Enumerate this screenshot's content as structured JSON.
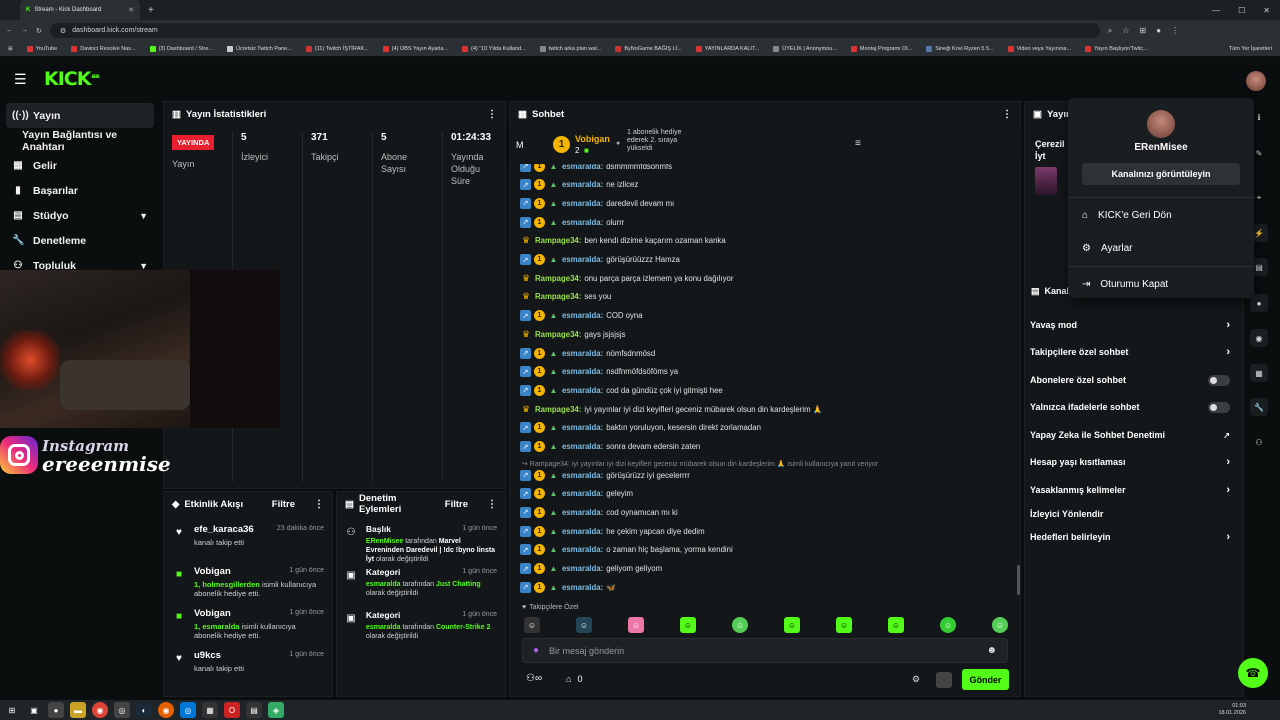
{
  "browser": {
    "tab_title": "Stream - Kick Dashboard",
    "url": "dashboard.kick.com/stream",
    "bookmarks": [
      "YouTube",
      "Davinci Resolve Nas...",
      "(3) Dashboard / Stre...",
      "Ücretsiz Twitch Pane...",
      "(11) Twitch İŞTİRAK...",
      "(4) OBS Yayın Ayarla...",
      "(4) \"10 Yılda Kulland...",
      "twitch arka plan wal...",
      "ByNoGame BAĞIŞ Lİ...",
      "YAYINLARDA KALIT...",
      "ÜYELİK | Anonymou...",
      "Montaj Programı Ol...",
      "Sineği Kovi Ryzen 5 5...",
      "Video veya Yayınına...",
      "Yayın Başlıyor/Twitc..."
    ],
    "bookmarks_all": "Tüm Yer İşaretleri"
  },
  "header": {
    "logo": "KICK",
    "beta": "BETA"
  },
  "sidebar": {
    "items": [
      {
        "label": "Yayın",
        "icon": "broadcast-icon"
      },
      {
        "label": "Yayın Bağlantısı ve Anahtarı",
        "icon": ""
      },
      {
        "label": "Gelir",
        "icon": "revenue-icon"
      },
      {
        "label": "Başarılar",
        "icon": "achievements-icon"
      },
      {
        "label": "Stüdyo",
        "icon": "studio-icon"
      },
      {
        "label": "Denetleme",
        "icon": "moderation-icon"
      },
      {
        "label": "Topluluk",
        "icon": "community-icon"
      }
    ]
  },
  "stats": {
    "title": "Yayın İstatistikleri",
    "live_badge": "YAYINDA",
    "live_label": "Yayın",
    "viewers": {
      "value": "5",
      "label": "İzleyici"
    },
    "followers": {
      "value": "371",
      "label": "Takipçi"
    },
    "subs": {
      "value": "5",
      "label": "Abone Sayısı"
    },
    "duration": {
      "value": "01:24:33",
      "label": "Yayında Olduğu Süre"
    }
  },
  "overlay": {
    "instagram_line1": "Instagram",
    "instagram_line2": "ereeenmise"
  },
  "chat": {
    "title": "Sohbet",
    "pinned_initial": "M",
    "gifter_name": "Vobigan",
    "gifter_count": "2",
    "gifter_note": "1 abonelik hediye ederek 2. sıraya yükseldi",
    "messages": [
      {
        "user": "esmaralda",
        "text": "dsmmmmfdsohmfs",
        "type": "sub"
      },
      {
        "user": "esmaralda",
        "text": "ne izlicez",
        "type": "sub"
      },
      {
        "user": "esmaralda",
        "text": "daredevil devam mı",
        "type": "sub"
      },
      {
        "user": "esmaralda",
        "text": "olurrr",
        "type": "sub"
      },
      {
        "user": "Rampage34",
        "text": "ben kendi dizime kaçarım ozaman kanka",
        "type": "mod"
      },
      {
        "user": "esmaralda",
        "text": "görüşürüüzzz Hamza",
        "type": "sub"
      },
      {
        "user": "Rampage34",
        "text": "onu parça parça izlemem ya konu dağılıyor",
        "type": "mod"
      },
      {
        "user": "Rampage34",
        "text": "ses you",
        "type": "mod"
      },
      {
        "user": "esmaralda",
        "text": "COD oyna",
        "type": "sub"
      },
      {
        "user": "Rampage34",
        "text": "gays jsjsjsjs",
        "type": "mod"
      },
      {
        "user": "esmaralda",
        "text": "nömfsdnmösd",
        "type": "sub"
      },
      {
        "user": "esmaralda",
        "text": "nsdfnmöfdsöföms ya",
        "type": "sub"
      },
      {
        "user": "esmaralda",
        "text": "cod da gündüz çok iyi gitmişti hee",
        "type": "sub"
      },
      {
        "user": "Rampage34",
        "text": "iyi yayınlar iyi dizi keyifleri geceniz mübarek olsun din kardeşlerim 🙏",
        "type": "mod"
      },
      {
        "user": "esmaralda",
        "text": "baktın yoruluyon, kesersin direkt zorlamadan",
        "type": "sub"
      },
      {
        "user": "esmaralda",
        "text": "sonra devam edersin zaten",
        "type": "sub"
      }
    ],
    "reply_note": "↪ Rampage34: iyi yayınlar iyi dizi keyifleri geceniz mübarek olsun din kardeşlerim 🙏 isimli kullanıcıya yanıt veriyor",
    "messages2": [
      {
        "user": "esmaralda",
        "text": "görüşürüzz iyi gecelerrrr"
      },
      {
        "user": "esmaralda",
        "text": "geleyim"
      },
      {
        "user": "esmaralda",
        "text": "cod oynamıcan mı ki"
      },
      {
        "user": "esmaralda",
        "text": "he çekim yapcan diye dedim"
      },
      {
        "user": "esmaralda",
        "text": "o zaman hiç başlama, yorma kendini"
      },
      {
        "user": "esmaralda",
        "text": "geliyom geliyom"
      },
      {
        "user": "esmaralda",
        "text": "🦋"
      }
    ],
    "followers_only": "Takipçilere Özel",
    "input_placeholder": "Bir mesaj gönderin",
    "viewer_count": "0",
    "send_label": "Gönder"
  },
  "activity": {
    "title": "Etkinlik Akışı",
    "filter": "Filtre",
    "items": [
      {
        "name": "efe_karaca36",
        "sub": "kanalı takip etti",
        "time": "23 dakika önce",
        "icon": "heart-icon"
      },
      {
        "name": "Vobigan",
        "sub_green": "1, holmesgillerden",
        "sub": "isimli kullanıcıya abonelik hediye etti.",
        "time": "1 gün önce",
        "icon": "gift-icon"
      },
      {
        "name": "Vobigan",
        "sub_green": "1, esmaralda",
        "sub": "isimli kullanıcıya abonelik hediye etti.",
        "time": "1 gün önce",
        "icon": "gift-icon"
      },
      {
        "name": "u9kcs",
        "sub": "kanalı takip etti",
        "time": "1 gün önce",
        "icon": "heart-icon"
      }
    ]
  },
  "modlog": {
    "title": "Denetim Eylemleri",
    "filter": "Filtre",
    "items": [
      {
        "name": "Başlık",
        "actor": "ERenMisee",
        "mid": "tarafından",
        "value": "Marvel Evreninden Daredevil | !dc !byno linsta İyt",
        "end": "olarak değiştirildi",
        "time": "1 gün önce"
      },
      {
        "name": "Kategori",
        "actor": "esmaralda",
        "mid": "tarafından",
        "value": "Just Chatting",
        "end": "olarak değiştirildi",
        "time": "1 gün önce"
      },
      {
        "name": "Kategori",
        "actor": "esmaralda",
        "mid": "tarafından",
        "value": "Counter-Strike 2",
        "end": "olarak değiştirildi",
        "time": "1 gün önce"
      }
    ]
  },
  "rightpanel": {
    "title": "Yayın",
    "reward_title": "Çerezil İyt",
    "channel_heading": "Kanal",
    "settings": [
      {
        "label": "Yavaş mod",
        "control": "chevron"
      },
      {
        "label": "Takipçilere özel sohbet",
        "control": "chevron"
      },
      {
        "label": "Abonelere özel sohbet",
        "control": "toggle"
      },
      {
        "label": "Yalnızca ifadelerle sohbet",
        "control": "toggle"
      },
      {
        "label": "Yapay Zeka ile Sohbet Denetimi",
        "control": "external"
      },
      {
        "label": "Hesap yaşı kısıtlaması",
        "control": "chevron"
      },
      {
        "label": "Yasaklanmış kelimeler",
        "control": "chevron"
      },
      {
        "label": "İzleyici Yönlendir",
        "control": "none"
      },
      {
        "label": "Hedefleri belirleyin",
        "control": "chevron"
      }
    ]
  },
  "dropdown": {
    "username": "ERenMisee",
    "view_channel": "Kanalınızı görüntüleyin",
    "items": [
      {
        "label": "KICK'e Geri Dön",
        "icon": "home-icon"
      },
      {
        "label": "Ayarlar",
        "icon": "gear-icon"
      },
      {
        "label": "Oturumu Kapat",
        "icon": "logout-icon"
      }
    ]
  },
  "taskbar": {
    "time": "01:03",
    "date": "18.01.2026"
  },
  "colors": {
    "brand": "#53fc18",
    "live": "#e91e2e",
    "panel": "#131719"
  }
}
